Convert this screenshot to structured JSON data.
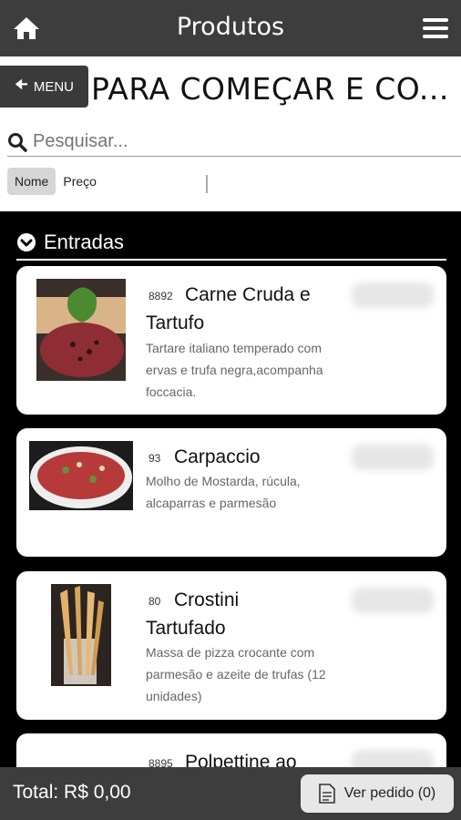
{
  "topbar": {
    "title": "Produtos"
  },
  "menu_label": "MENU",
  "category_title": "PARA COMEÇAR E CO...",
  "search": {
    "placeholder": "Pesquisar..."
  },
  "sort": {
    "active": "Nome",
    "other": "Preço"
  },
  "section": {
    "title": "Entradas"
  },
  "items": [
    {
      "code": "8892",
      "name": "Carne Cruda e Tartufo",
      "description": "Tartare italiano temperado com ervas e trufa negra,acompanha foccacia."
    },
    {
      "code": "93",
      "name": "Carpaccio",
      "description": "Molho de Mostarda, rúcula, alcaparras e parmesão"
    },
    {
      "code": "80",
      "name": "Crostini Tartufado",
      "description": "Massa de pizza crocante com parmesão e azeite de trufas (12 unidades)"
    },
    {
      "code": "8895",
      "name": "Polpettine ao"
    }
  ],
  "bottombar": {
    "total": "Total: R$ 0,00",
    "order_label": "Ver pedido (0)"
  },
  "icons": [
    "home-icon",
    "hamburger-menu-icon",
    "arrow-left-icon",
    "search-icon",
    "chevron-down-circle-icon",
    "document-icon"
  ]
}
